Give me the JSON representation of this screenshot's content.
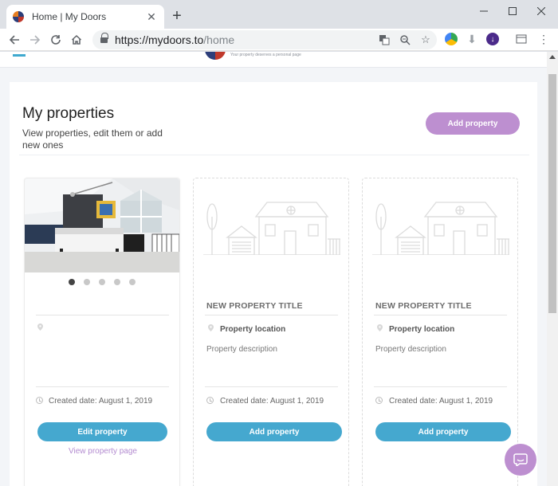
{
  "browser": {
    "tab_title": "Home | My Doors",
    "url_host": "https://mydoors.to",
    "url_path": "/home"
  },
  "site": {
    "tagline": "Your property deserves a personal page"
  },
  "properties": {
    "title": "My properties",
    "subtitle": "View properties, edit them or add new ones",
    "add_button": "Add property",
    "cards": [
      {
        "title": "",
        "location": "",
        "description": "",
        "created": "Created date: August 1, 2019",
        "button": "Edit property",
        "link": "View property page",
        "photo_count": 5,
        "active_photo": 1
      },
      {
        "title": "NEW PROPERTY TITLE",
        "location": "Property location",
        "description": "Property description",
        "created": "Created date: August 1, 2019",
        "button": "Add property"
      },
      {
        "title": "NEW PROPERTY TITLE",
        "location": "Property location",
        "description": "Property description",
        "created": "Created date: August 1, 2019",
        "button": "Add property"
      }
    ]
  },
  "colors": {
    "accent_blue": "#45a8cf",
    "accent_purple": "#bd8fd0"
  }
}
